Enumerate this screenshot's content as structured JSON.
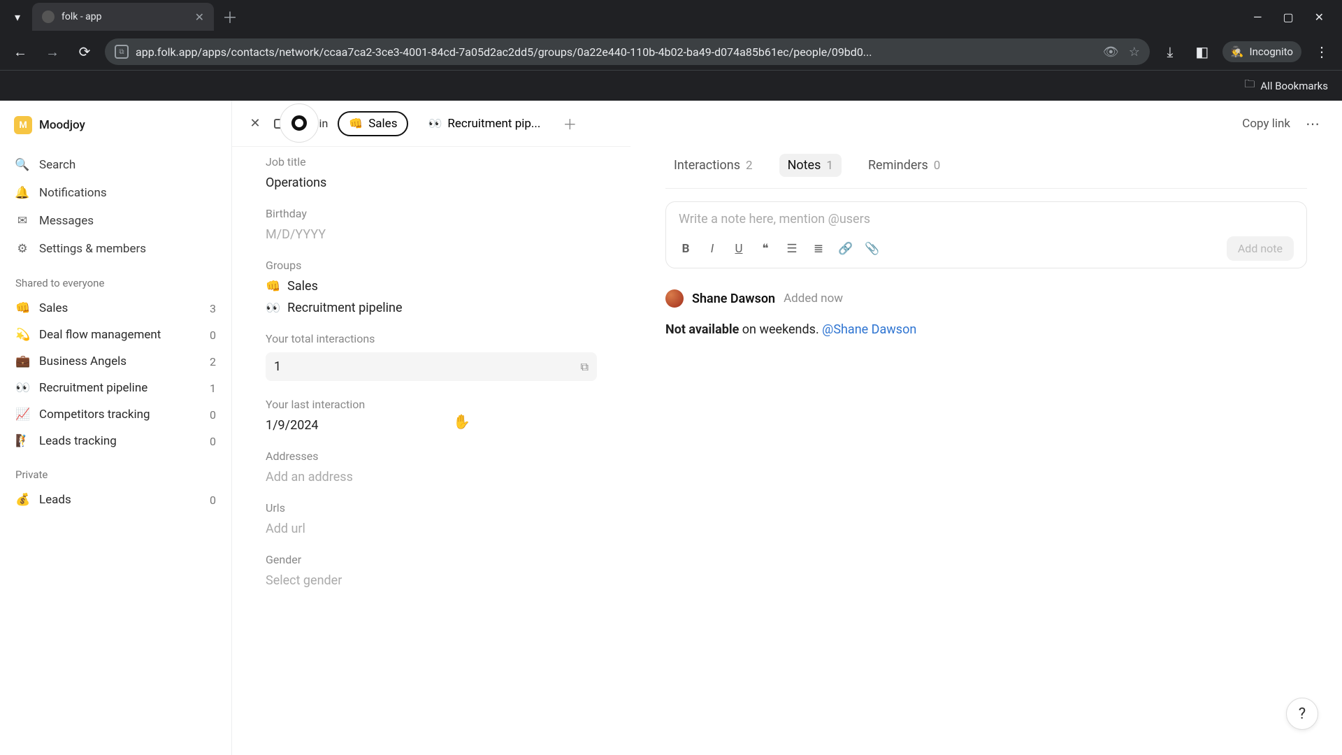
{
  "browser": {
    "tab_title": "folk - app",
    "url": "app.folk.app/apps/contacts/network/ccaa7ca2-3ce3-4001-84cd-7a05d2ac2dd5/groups/0a22e440-110b-4b02-ba49-d074a85b61ec/people/09bd0...",
    "incognito_label": "Incognito",
    "bookmarks_label": "All Bookmarks"
  },
  "workspace": {
    "initial": "M",
    "name": "Moodjoy"
  },
  "nav": {
    "search": "Search",
    "notifications": "Notifications",
    "messages": "Messages",
    "settings": "Settings & members"
  },
  "sections": {
    "shared": "Shared to everyone",
    "private": "Private"
  },
  "groups_shared": [
    {
      "emoji": "👊",
      "label": "Sales",
      "count": "3"
    },
    {
      "emoji": "💫",
      "label": "Deal flow management",
      "count": "0"
    },
    {
      "emoji": "💼",
      "label": "Business Angels",
      "count": "2"
    },
    {
      "emoji": "👀",
      "label": "Recruitment pipeline",
      "count": "1"
    },
    {
      "emoji": "📈",
      "label": "Competitors tracking",
      "count": "0"
    },
    {
      "emoji": "🧗",
      "label": "Leads tracking",
      "count": "0"
    }
  ],
  "groups_private": [
    {
      "emoji": "💰",
      "label": "Leads",
      "count": "0"
    }
  ],
  "viewbar": {
    "view_in": "View in",
    "pill_sales": "Sales",
    "pill_sales_emoji": "👊",
    "pill_recruit": "Recruitment pip...",
    "pill_recruit_emoji": "👀"
  },
  "fields": {
    "job_title_label": "Job title",
    "job_title_value": "Operations",
    "birthday_label": "Birthday",
    "birthday_placeholder": "M/D/YYYY",
    "groups_label": "Groups",
    "group_sales": "Sales",
    "group_sales_emoji": "👊",
    "group_recruit": "Recruitment pipeline",
    "group_recruit_emoji": "👀",
    "total_label": "Your total interactions",
    "total_value": "1",
    "last_label": "Your last interaction",
    "last_value": "1/9/2024",
    "addresses_label": "Addresses",
    "addresses_placeholder": "Add an address",
    "urls_label": "Urls",
    "urls_placeholder": "Add url",
    "gender_label": "Gender",
    "gender_placeholder": "Select gender"
  },
  "rightpane": {
    "copylink": "Copy link",
    "tabs": {
      "interactions_label": "Interactions",
      "interactions_count": "2",
      "notes_label": "Notes",
      "notes_count": "1",
      "reminders_label": "Reminders",
      "reminders_count": "0"
    },
    "editor_placeholder": "Write a note here, mention @users",
    "addnote": "Add note",
    "note": {
      "author": "Shane Dawson",
      "meta": "Added now",
      "bold": "Not available",
      "plain": " on weekends. ",
      "mention": "@Shane Dawson"
    }
  },
  "help": "?"
}
